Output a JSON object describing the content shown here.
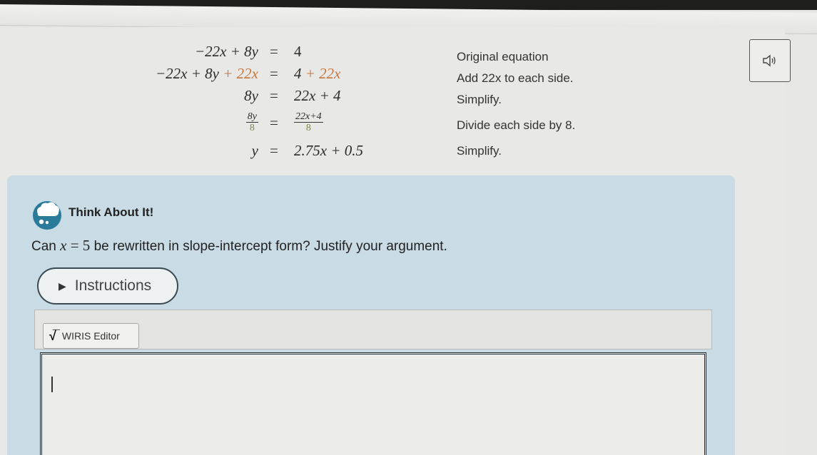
{
  "equations": [
    {
      "lhs": "−22x + 8y",
      "sign": "=",
      "rhs": "4",
      "note": "Original equation"
    },
    {
      "lhs_parts": [
        "−22x + 8y",
        " + 22x"
      ],
      "sign": "=",
      "rhs_parts": [
        "4",
        " + 22x"
      ],
      "note": "Add 22x to each side."
    },
    {
      "lhs": "8y",
      "sign": "=",
      "rhs": "22x + 4",
      "note": "Simplify."
    },
    {
      "lhs_frac": {
        "num": "8y",
        "den": "8"
      },
      "sign": "=",
      "rhs_frac": {
        "num": "22x+4",
        "den": "8"
      },
      "note": "Divide each side by 8."
    },
    {
      "lhs": "y",
      "sign": "=",
      "rhs": "2.75x + 0.5",
      "note": "Simplify."
    }
  ],
  "audio_button": {
    "icon": "speaker-icon"
  },
  "think": {
    "title": "Think About It!",
    "icon": "thought-cloud-icon",
    "question_before": "Can ",
    "question_math_var": "x",
    "question_math_rest": " = 5",
    "question_after": " be rewritten in slope-intercept form? Justify your argument."
  },
  "instructions": {
    "label": "Instructions",
    "icon": "play-triangle-icon"
  },
  "editor": {
    "wiris_label": "WIRIS Editor",
    "icon": "sqrt-icon",
    "value": ""
  },
  "colors": {
    "highlight_orange": "#c8763e",
    "denominator_green": "#7a8a4a",
    "panel_blue": "#c9dbe5"
  }
}
